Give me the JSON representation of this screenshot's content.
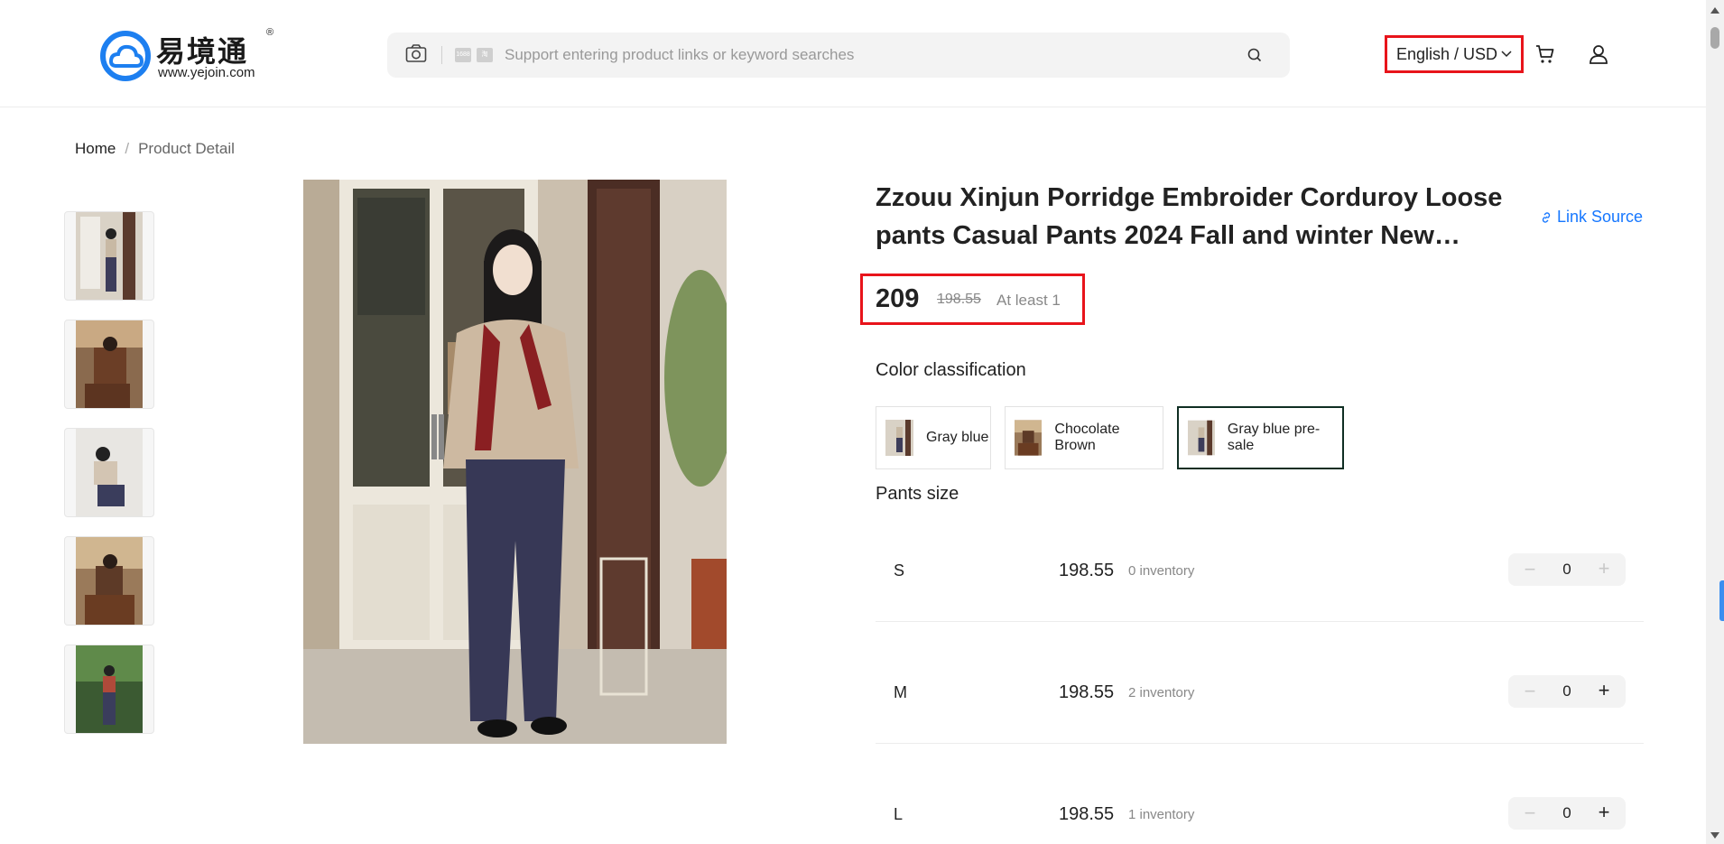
{
  "header": {
    "logo_cn": "易境通",
    "logo_reg": "®",
    "logo_url": "www.yejoin.com",
    "search_placeholder": "Support entering product links or keyword searches",
    "language_currency": "English / USD"
  },
  "breadcrumb": {
    "home": "Home",
    "separator": "/",
    "current": "Product Detail"
  },
  "product": {
    "title": "Zzouu Xinjun Porridge Embroider Corduroy Loose pants Casual Pants 2024 Fall and winter New…",
    "link_source": "Link Source",
    "price": "209",
    "original_price": "198.55",
    "min_order": "At least 1",
    "color_label": "Color classification",
    "colors": [
      {
        "label": "Gray blue",
        "selected": false
      },
      {
        "label": "Chocolate Brown",
        "selected": false
      },
      {
        "label": "Gray blue pre-sale",
        "selected": true
      }
    ],
    "size_label": "Pants size",
    "sizes": [
      {
        "size": "S",
        "price": "198.55",
        "inventory": "0 inventory",
        "qty": "0",
        "plus_enabled": false
      },
      {
        "size": "M",
        "price": "198.55",
        "inventory": "2 inventory",
        "qty": "0",
        "plus_enabled": true
      },
      {
        "size": "L",
        "price": "198.55",
        "inventory": "1 inventory",
        "qty": "0",
        "plus_enabled": true
      }
    ],
    "stepper_minus": "−",
    "stepper_plus": "+"
  },
  "colors": {
    "brand_blue": "#1677ff",
    "highlight_red": "#e8141b",
    "selected_border": "#0f2e23"
  }
}
